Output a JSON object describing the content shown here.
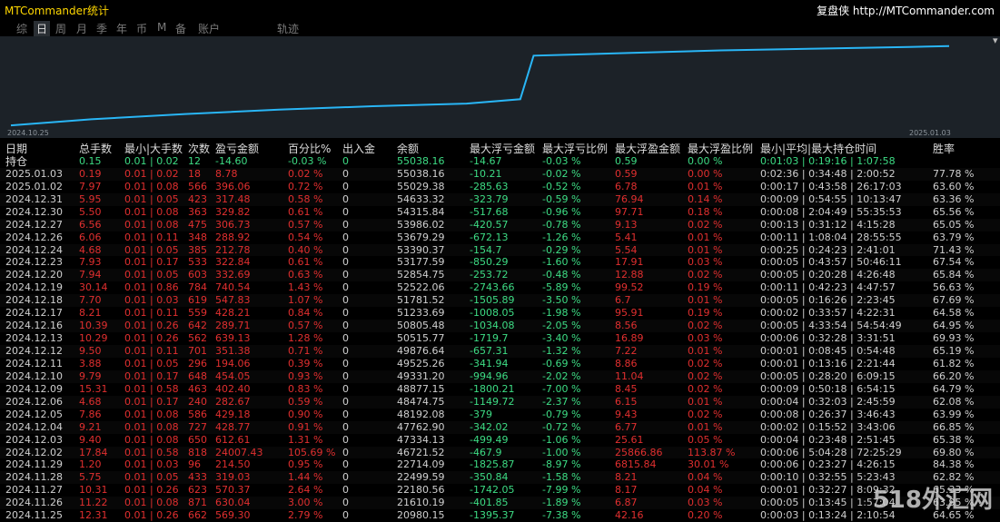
{
  "app": {
    "title": "MTCommander统计",
    "brand": "复盘侠 http://MTCommander.com"
  },
  "tabs": [
    {
      "label": "综",
      "active": false
    },
    {
      "label": "日",
      "active": true
    },
    {
      "label": "周",
      "active": false
    },
    {
      "label": "月",
      "active": false
    },
    {
      "label": "季",
      "active": false
    },
    {
      "label": "年",
      "active": false
    },
    {
      "label": "币",
      "active": false
    },
    {
      "label": "M",
      "active": false
    },
    {
      "label": "备",
      "active": false
    },
    {
      "label": "账户",
      "active": false
    },
    {
      "label": "轨迹",
      "active": false
    }
  ],
  "panel_toggle_glyph": "▾",
  "chart_data": {
    "type": "line",
    "line_color": "#29b6f6",
    "background": "#1c2228",
    "x_start_label": "2024.10.25",
    "x_end_label": "2025.01.03",
    "x": [
      "2024.10.25",
      "2024.10.31",
      "2024.11.07",
      "2024.11.14",
      "2024.11.21",
      "2024.11.28",
      "2024.12.02",
      "2024.12.03",
      "2024.12.10",
      "2024.12.17",
      "2024.12.24",
      "2024.12.31",
      "2025.01.03"
    ],
    "values": [
      0.02,
      0.09,
      0.15,
      0.2,
      0.24,
      0.27,
      0.32,
      0.82,
      0.85,
      0.88,
      0.9,
      0.92,
      0.93
    ],
    "ylim": [
      0,
      1
    ]
  },
  "table": {
    "columns": [
      "日期",
      "总手数",
      "最小|大手数",
      "次数",
      "盈亏金额",
      "百分比%",
      "出入金",
      "余额",
      "最大浮亏金额",
      "最大浮亏比例",
      "最大浮盈金额",
      "最大浮盈比例",
      "最小|平均|最大持仓时间",
      "胜率"
    ],
    "holding": {
      "label": "持仓",
      "lots": "0.15",
      "minmax": "0.01 | 0.02",
      "count": "12",
      "pnl": "-14.60",
      "pct": "-0.03 %",
      "io": "0",
      "balance": "55038.16",
      "maxloss": "-14.67",
      "maxlosspct": "-0.03 %",
      "maxprofit": "0.59",
      "maxprofitpct": "0.00 %",
      "hold": "0:01:03 | 0:19:16 | 1:07:58",
      "win": ""
    },
    "rows": [
      {
        "date": "2025.01.03",
        "lots": "0.19",
        "minmax": "0.01 | 0.02",
        "count": "18",
        "pnl": "8.78",
        "pct": "0.02 %",
        "io": "0",
        "balance": "55038.16",
        "maxloss": "-10.21",
        "maxlosspct": "-0.02 %",
        "maxprofit": "0.59",
        "maxprofitpct": "0.00 %",
        "hold": "0:02:36 | 0:34:48 | 2:00:52",
        "win": "77.78 %"
      },
      {
        "date": "2025.01.02",
        "lots": "7.97",
        "minmax": "0.01 | 0.08",
        "count": "566",
        "pnl": "396.06",
        "pct": "0.72 %",
        "io": "0",
        "balance": "55029.38",
        "maxloss": "-285.63",
        "maxlosspct": "-0.52 %",
        "maxprofit": "6.78",
        "maxprofitpct": "0.01 %",
        "hold": "0:00:17 | 0:43:58 | 26:17:03",
        "win": "63.60 %"
      },
      {
        "date": "2024.12.31",
        "lots": "5.95",
        "minmax": "0.01 | 0.05",
        "count": "423",
        "pnl": "317.48",
        "pct": "0.58 %",
        "io": "0",
        "balance": "54633.32",
        "maxloss": "-323.79",
        "maxlosspct": "-0.59 %",
        "maxprofit": "76.94",
        "maxprofitpct": "0.14 %",
        "hold": "0:00:09 | 0:54:55 | 10:13:47",
        "win": "63.36 %"
      },
      {
        "date": "2024.12.30",
        "lots": "5.50",
        "minmax": "0.01 | 0.08",
        "count": "363",
        "pnl": "329.82",
        "pct": "0.61 %",
        "io": "0",
        "balance": "54315.84",
        "maxloss": "-517.68",
        "maxlosspct": "-0.96 %",
        "maxprofit": "97.71",
        "maxprofitpct": "0.18 %",
        "hold": "0:00:08 | 2:04:49 | 55:35:53",
        "win": "65.56 %"
      },
      {
        "date": "2024.12.27",
        "lots": "6.56",
        "minmax": "0.01 | 0.08",
        "count": "475",
        "pnl": "306.73",
        "pct": "0.57 %",
        "io": "0",
        "balance": "53986.02",
        "maxloss": "-420.57",
        "maxlosspct": "-0.78 %",
        "maxprofit": "9.13",
        "maxprofitpct": "0.02 %",
        "hold": "0:00:13 | 0:31:12 | 4:15:28",
        "win": "65.05 %"
      },
      {
        "date": "2024.12.26",
        "lots": "6.06",
        "minmax": "0.01 | 0.11",
        "count": "348",
        "pnl": "288.92",
        "pct": "0.54 %",
        "io": "0",
        "balance": "53679.29",
        "maxloss": "-672.13",
        "maxlosspct": "-1.26 %",
        "maxprofit": "5.41",
        "maxprofitpct": "0.01 %",
        "hold": "0:00:11 | 1:08:04 | 28:55:55",
        "win": "63.79 %"
      },
      {
        "date": "2024.12.24",
        "lots": "4.68",
        "minmax": "0.01 | 0.05",
        "count": "385",
        "pnl": "212.78",
        "pct": "0.40 %",
        "io": "0",
        "balance": "53390.37",
        "maxloss": "-154.7",
        "maxlosspct": "-0.29 %",
        "maxprofit": "5.54",
        "maxprofitpct": "0.01 %",
        "hold": "0:00:25 | 0:24:23 | 2:41:01",
        "win": "71.43 %"
      },
      {
        "date": "2024.12.23",
        "lots": "7.93",
        "minmax": "0.01 | 0.17",
        "count": "533",
        "pnl": "322.84",
        "pct": "0.61 %",
        "io": "0",
        "balance": "53177.59",
        "maxloss": "-850.29",
        "maxlosspct": "-1.60 %",
        "maxprofit": "17.91",
        "maxprofitpct": "0.03 %",
        "hold": "0:00:05 | 0:43:57 | 50:46:11",
        "win": "67.54 %"
      },
      {
        "date": "2024.12.20",
        "lots": "7.94",
        "minmax": "0.01 | 0.05",
        "count": "603",
        "pnl": "332.69",
        "pct": "0.63 %",
        "io": "0",
        "balance": "52854.75",
        "maxloss": "-253.72",
        "maxlosspct": "-0.48 %",
        "maxprofit": "12.88",
        "maxprofitpct": "0.02 %",
        "hold": "0:00:05 | 0:20:28 | 4:26:48",
        "win": "65.84 %"
      },
      {
        "date": "2024.12.19",
        "lots": "30.14",
        "minmax": "0.01 | 0.86",
        "count": "784",
        "pnl": "740.54",
        "pct": "1.43 %",
        "io": "0",
        "balance": "52522.06",
        "maxloss": "-2743.66",
        "maxlosspct": "-5.89 %",
        "maxprofit": "99.52",
        "maxprofitpct": "0.19 %",
        "hold": "0:00:11 | 0:42:23 | 4:47:57",
        "win": "56.63 %"
      },
      {
        "date": "2024.12.18",
        "lots": "7.70",
        "minmax": "0.01 | 0.03",
        "count": "619",
        "pnl": "547.83",
        "pct": "1.07 %",
        "io": "0",
        "balance": "51781.52",
        "maxloss": "-1505.89",
        "maxlosspct": "-3.50 %",
        "maxprofit": "6.7",
        "maxprofitpct": "0.01 %",
        "hold": "0:00:05 | 0:16:26 | 2:23:45",
        "win": "67.69 %"
      },
      {
        "date": "2024.12.17",
        "lots": "8.21",
        "minmax": "0.01 | 0.11",
        "count": "559",
        "pnl": "428.21",
        "pct": "0.84 %",
        "io": "0",
        "balance": "51233.69",
        "maxloss": "-1008.05",
        "maxlosspct": "-1.98 %",
        "maxprofit": "95.91",
        "maxprofitpct": "0.19 %",
        "hold": "0:00:02 | 0:33:57 | 4:22:31",
        "win": "64.58 %"
      },
      {
        "date": "2024.12.16",
        "lots": "10.39",
        "minmax": "0.01 | 0.26",
        "count": "642",
        "pnl": "289.71",
        "pct": "0.57 %",
        "io": "0",
        "balance": "50805.48",
        "maxloss": "-1034.08",
        "maxlosspct": "-2.05 %",
        "maxprofit": "8.56",
        "maxprofitpct": "0.02 %",
        "hold": "0:00:05 | 4:33:54 | 54:54:49",
        "win": "64.95 %"
      },
      {
        "date": "2024.12.13",
        "lots": "10.29",
        "minmax": "0.01 | 0.26",
        "count": "562",
        "pnl": "639.13",
        "pct": "1.28 %",
        "io": "0",
        "balance": "50515.77",
        "maxloss": "-1719.7",
        "maxlosspct": "-3.40 %",
        "maxprofit": "16.89",
        "maxprofitpct": "0.03 %",
        "hold": "0:00:06 | 0:32:28 | 3:31:51",
        "win": "69.93 %"
      },
      {
        "date": "2024.12.12",
        "lots": "9.50",
        "minmax": "0.01 | 0.11",
        "count": "701",
        "pnl": "351.38",
        "pct": "0.71 %",
        "io": "0",
        "balance": "49876.64",
        "maxloss": "-657.31",
        "maxlosspct": "-1.32 %",
        "maxprofit": "7.22",
        "maxprofitpct": "0.01 %",
        "hold": "0:00:01 | 0:08:45 | 0:54:48",
        "win": "65.19 %"
      },
      {
        "date": "2024.12.11",
        "lots": "3.88",
        "minmax": "0.01 | 0.05",
        "count": "296",
        "pnl": "194.06",
        "pct": "0.39 %",
        "io": "0",
        "balance": "49525.26",
        "maxloss": "-341.94",
        "maxlosspct": "-0.69 %",
        "maxprofit": "8.86",
        "maxprofitpct": "0.02 %",
        "hold": "0:00:01 | 0:13:16 | 2:21:44",
        "win": "61.82 %"
      },
      {
        "date": "2024.12.10",
        "lots": "9.79",
        "minmax": "0.01 | 0.17",
        "count": "648",
        "pnl": "454.05",
        "pct": "0.93 %",
        "io": "0",
        "balance": "49331.20",
        "maxloss": "-994.96",
        "maxlosspct": "-2.02 %",
        "maxprofit": "11.04",
        "maxprofitpct": "0.02 %",
        "hold": "0:00:05 | 0:28:20 | 6:09:15",
        "win": "66.20 %"
      },
      {
        "date": "2024.12.09",
        "lots": "15.31",
        "minmax": "0.01 | 0.58",
        "count": "463",
        "pnl": "402.40",
        "pct": "0.83 %",
        "io": "0",
        "balance": "48877.15",
        "maxloss": "-1800.21",
        "maxlosspct": "-7.00 %",
        "maxprofit": "8.45",
        "maxprofitpct": "0.02 %",
        "hold": "0:00:09 | 0:50:18 | 6:54:15",
        "win": "64.79 %"
      },
      {
        "date": "2024.12.06",
        "lots": "4.68",
        "minmax": "0.01 | 0.17",
        "count": "240",
        "pnl": "282.67",
        "pct": "0.59 %",
        "io": "0",
        "balance": "48474.75",
        "maxloss": "-1149.72",
        "maxlosspct": "-2.37 %",
        "maxprofit": "6.15",
        "maxprofitpct": "0.01 %",
        "hold": "0:00:04 | 0:32:03 | 2:45:59",
        "win": "62.08 %"
      },
      {
        "date": "2024.12.05",
        "lots": "7.86",
        "minmax": "0.01 | 0.08",
        "count": "586",
        "pnl": "429.18",
        "pct": "0.90 %",
        "io": "0",
        "balance": "48192.08",
        "maxloss": "-379",
        "maxlosspct": "-0.79 %",
        "maxprofit": "9.43",
        "maxprofitpct": "0.02 %",
        "hold": "0:00:08 | 0:26:37 | 3:46:43",
        "win": "63.99 %"
      },
      {
        "date": "2024.12.04",
        "lots": "9.21",
        "minmax": "0.01 | 0.08",
        "count": "727",
        "pnl": "428.77",
        "pct": "0.91 %",
        "io": "0",
        "balance": "47762.90",
        "maxloss": "-342.02",
        "maxlosspct": "-0.72 %",
        "maxprofit": "6.77",
        "maxprofitpct": "0.01 %",
        "hold": "0:00:02 | 0:15:52 | 3:43:06",
        "win": "66.85 %"
      },
      {
        "date": "2024.12.03",
        "lots": "9.40",
        "minmax": "0.01 | 0.08",
        "count": "650",
        "pnl": "612.61",
        "pct": "1.31 %",
        "io": "0",
        "balance": "47334.13",
        "maxloss": "-499.49",
        "maxlosspct": "-1.06 %",
        "maxprofit": "25.61",
        "maxprofitpct": "0.05 %",
        "hold": "0:00:04 | 0:23:48 | 2:51:45",
        "win": "65.38 %"
      },
      {
        "date": "2024.12.02",
        "lots": "17.84",
        "minmax": "0.01 | 0.58",
        "count": "818",
        "pnl": "24007.43",
        "pct": "105.69 %",
        "io": "0",
        "balance": "46721.52",
        "maxloss": "-467.9",
        "maxlosspct": "-1.00 %",
        "maxprofit": "25866.86",
        "maxprofitpct": "113.87 %",
        "hold": "0:00:06 | 5:04:28 | 72:25:29",
        "win": "69.80 %"
      },
      {
        "date": "2024.11.29",
        "lots": "1.20",
        "minmax": "0.01 | 0.03",
        "count": "96",
        "pnl": "214.50",
        "pct": "0.95 %",
        "io": "0",
        "balance": "22714.09",
        "maxloss": "-1825.87",
        "maxlosspct": "-8.97 %",
        "maxprofit": "6815.84",
        "maxprofitpct": "30.01 %",
        "hold": "0:00:06 | 0:23:27 | 4:26:15",
        "win": "84.38 %"
      },
      {
        "date": "2024.11.28",
        "lots": "5.75",
        "minmax": "0.01 | 0.05",
        "count": "433",
        "pnl": "319.03",
        "pct": "1.44 %",
        "io": "0",
        "balance": "22499.59",
        "maxloss": "-350.84",
        "maxlosspct": "-1.58 %",
        "maxprofit": "8.21",
        "maxprofitpct": "0.04 %",
        "hold": "0:00:10 | 0:32:55 | 5:23:43",
        "win": "62.82 %"
      },
      {
        "date": "2024.11.27",
        "lots": "10.31",
        "minmax": "0.01 | 0.26",
        "count": "623",
        "pnl": "570.37",
        "pct": "2.64 %",
        "io": "0",
        "balance": "22180.56",
        "maxloss": "-1742.05",
        "maxlosspct": "-7.99 %",
        "maxprofit": "8.17",
        "maxprofitpct": "0.04 %",
        "hold": "0:00:01 | 0:32:27 | 8:09:32",
        "win": "65.33 %"
      },
      {
        "date": "2024.11.26",
        "lots": "11.22",
        "minmax": "0.01 | 0.08",
        "count": "871",
        "pnl": "630.04",
        "pct": "3.00 %",
        "io": "0",
        "balance": "21610.19",
        "maxloss": "-401.85",
        "maxlosspct": "-1.89 %",
        "maxprofit": "6.87",
        "maxprofitpct": "0.03 %",
        "hold": "0:00:05 | 0:13:45 | 1:57:04",
        "win": "63.95 %"
      },
      {
        "date": "2024.11.25",
        "lots": "12.31",
        "minmax": "0.01 | 0.26",
        "count": "662",
        "pnl": "569.30",
        "pct": "2.79 %",
        "io": "0",
        "balance": "20980.15",
        "maxloss": "-1395.37",
        "maxlosspct": "-7.38 %",
        "maxprofit": "42.16",
        "maxprofitpct": "0.20 %",
        "hold": "0:00:03 | 0:13:24 | 2:10:54",
        "win": "64.65 %"
      }
    ]
  },
  "watermark": "518外汇网",
  "colors": {
    "title": "#ffd700",
    "positive": "#e12f2f",
    "negative": "#3ddc84",
    "line": "#29b6f6"
  }
}
